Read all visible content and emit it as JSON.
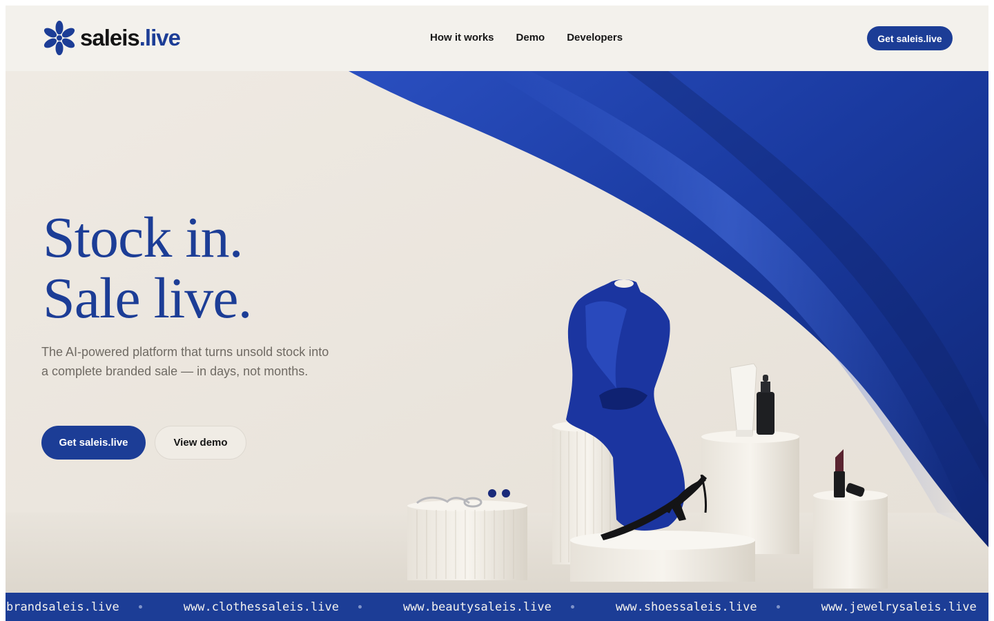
{
  "brand": {
    "name_main": "saleis",
    "name_accent": ".live",
    "accent_color": "#1c3d96",
    "icon": "asterisk-flower-icon"
  },
  "nav": {
    "items": [
      {
        "label": "How it works"
      },
      {
        "label": "Demo"
      },
      {
        "label": "Developers"
      }
    ]
  },
  "header": {
    "cta_label": "Get saleis.live"
  },
  "hero": {
    "headline_line1": "Stock in.",
    "headline_line2": "Sale live.",
    "subtitle": "The AI-powered platform that turns unsold stock into a complete branded sale — in days, not months.",
    "primary_cta": "Get saleis.live",
    "secondary_cta": "View demo",
    "image_subject": "product display: blue satin drape, dress on mannequin, black slingback heel, jewelry, skincare bottles, lipstick on white pedestals"
  },
  "ticker": {
    "items": [
      "brandsaleis.live",
      "www.clothessaleis.live",
      "www.beautysaleis.live",
      "www.shoessaleis.live",
      "www.jewelrysaleis.live"
    ]
  }
}
